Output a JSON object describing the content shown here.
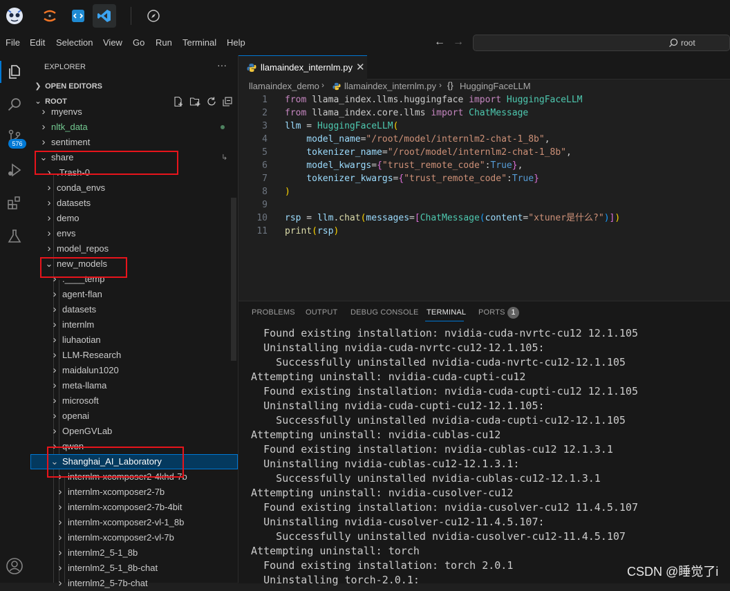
{
  "menu": [
    "File",
    "Edit",
    "Selection",
    "View",
    "Go",
    "Run",
    "Terminal",
    "Help"
  ],
  "search": {
    "text": "root"
  },
  "activity": {
    "badge": "576"
  },
  "explorer": {
    "title": "EXPLORER",
    "more": "···",
    "open_editors": "OPEN EDITORS",
    "root": "ROOT",
    "items": [
      {
        "label": "myenvs",
        "depth": 0,
        "expanded": false
      },
      {
        "label": "nltk_data",
        "depth": 0,
        "expanded": false,
        "color": "#73c991",
        "dot": true
      },
      {
        "label": "sentiment",
        "depth": 0,
        "expanded": false
      },
      {
        "label": "share",
        "depth": 0,
        "expanded": true,
        "mark": "↳"
      },
      {
        "label": ".Trash-0",
        "depth": 1,
        "expanded": false
      },
      {
        "label": "conda_envs",
        "depth": 1,
        "expanded": false
      },
      {
        "label": "datasets",
        "depth": 1,
        "expanded": false
      },
      {
        "label": "demo",
        "depth": 1,
        "expanded": false
      },
      {
        "label": "envs",
        "depth": 1,
        "expanded": false
      },
      {
        "label": "model_repos",
        "depth": 1,
        "expanded": false
      },
      {
        "label": "new_models",
        "depth": 1,
        "expanded": true
      },
      {
        "label": ".____temp",
        "depth": 2,
        "expanded": false
      },
      {
        "label": "agent-flan",
        "depth": 2,
        "expanded": false
      },
      {
        "label": "datasets",
        "depth": 2,
        "expanded": false
      },
      {
        "label": "internlm",
        "depth": 2,
        "expanded": false
      },
      {
        "label": "liuhaotian",
        "depth": 2,
        "expanded": false
      },
      {
        "label": "LLM-Research",
        "depth": 2,
        "expanded": false
      },
      {
        "label": "maidalun1020",
        "depth": 2,
        "expanded": false
      },
      {
        "label": "meta-llama",
        "depth": 2,
        "expanded": false
      },
      {
        "label": "microsoft",
        "depth": 2,
        "expanded": false
      },
      {
        "label": "openai",
        "depth": 2,
        "expanded": false
      },
      {
        "label": "OpenGVLab",
        "depth": 2,
        "expanded": false
      },
      {
        "label": "qwen",
        "depth": 2,
        "expanded": false
      },
      {
        "label": "Shanghai_AI_Laboratory",
        "depth": 2,
        "expanded": true,
        "selected": true
      },
      {
        "label": "internlm-xcomposer2-4khd-7b",
        "depth": 3,
        "expanded": false
      },
      {
        "label": "internlm-xcomposer2-7b",
        "depth": 3,
        "expanded": false
      },
      {
        "label": "internlm-xcomposer2-7b-4bit",
        "depth": 3,
        "expanded": false
      },
      {
        "label": "internlm-xcomposer2-vl-1_8b",
        "depth": 3,
        "expanded": false
      },
      {
        "label": "internlm-xcomposer2-vl-7b",
        "depth": 3,
        "expanded": false
      },
      {
        "label": "internlm2_5-1_8b",
        "depth": 3,
        "expanded": false
      },
      {
        "label": "internlm2_5-1_8b-chat",
        "depth": 3,
        "expanded": false
      },
      {
        "label": "internlm2_5-7b-chat",
        "depth": 3,
        "expanded": false
      }
    ]
  },
  "editor": {
    "tab_label": "llamaindex_internlm.py",
    "breadcrumb": [
      "llamaindex_demo",
      "llamaindex_internlm.py",
      "HuggingFaceLLM"
    ],
    "lines": [
      [
        [
          "from",
          "kw"
        ],
        [
          " llama_index.llms.huggingface ",
          ""
        ],
        [
          "import",
          "kw"
        ],
        [
          " HuggingFaceLLM",
          "cls"
        ]
      ],
      [
        [
          "from",
          "kw"
        ],
        [
          " llama_index.core.llms ",
          ""
        ],
        [
          "import",
          "kw"
        ],
        [
          " ChatMessage",
          "cls"
        ]
      ],
      [
        [
          "llm",
          "var"
        ],
        [
          " = ",
          ""
        ],
        [
          "HuggingFaceLLM",
          "cls"
        ],
        [
          "(",
          "par"
        ]
      ],
      [
        [
          "    model_name",
          "var"
        ],
        [
          "=",
          ""
        ],
        [
          "\"/root/model/internlm2-chat-1_8b\"",
          "str"
        ],
        [
          ",",
          ""
        ]
      ],
      [
        [
          "    tokenizer_name",
          "var"
        ],
        [
          "=",
          ""
        ],
        [
          "\"/root/model/internlm2-chat-1_8b\"",
          "str"
        ],
        [
          ",",
          ""
        ]
      ],
      [
        [
          "    model_kwargs",
          "var"
        ],
        [
          "=",
          ""
        ],
        [
          "{",
          "par2"
        ],
        [
          "\"trust_remote_code\"",
          "str"
        ],
        [
          ":",
          ""
        ],
        [
          "True",
          "const"
        ],
        [
          "}",
          "par2"
        ],
        [
          ",",
          ""
        ]
      ],
      [
        [
          "    tokenizer_kwargs",
          "var"
        ],
        [
          "=",
          ""
        ],
        [
          "{",
          "par2"
        ],
        [
          "\"trust_remote_code\"",
          "str"
        ],
        [
          ":",
          ""
        ],
        [
          "True",
          "const"
        ],
        [
          "}",
          "par2"
        ]
      ],
      [
        [
          ")",
          "par"
        ]
      ],
      [],
      [
        [
          "rsp",
          "var"
        ],
        [
          " = ",
          ""
        ],
        [
          "llm",
          "var"
        ],
        [
          ".",
          ""
        ],
        [
          "chat",
          "fn"
        ],
        [
          "(",
          "par"
        ],
        [
          "messages",
          "var"
        ],
        [
          "=",
          ""
        ],
        [
          "[",
          "par2"
        ],
        [
          "ChatMessage",
          "cls"
        ],
        [
          "(",
          "par3"
        ],
        [
          "content",
          "var"
        ],
        [
          "=",
          ""
        ],
        [
          "\"xtuner是什么?\"",
          "str"
        ],
        [
          ")",
          "par3"
        ],
        [
          "]",
          "par2"
        ],
        [
          ")",
          "par"
        ]
      ],
      [
        [
          "print",
          "fn"
        ],
        [
          "(",
          "par"
        ],
        [
          "rsp",
          "var"
        ],
        [
          ")",
          "par"
        ]
      ]
    ]
  },
  "panel": {
    "tabs": [
      "PROBLEMS",
      "OUTPUT",
      "DEBUG CONSOLE",
      "TERMINAL",
      "PORTS"
    ],
    "active_tab": "TERMINAL",
    "ports_count": "1",
    "terminal_lines": [
      "    Found existing installation: nvidia-cuda-nvrtc-cu12 12.1.105",
      "    Uninstalling nvidia-cuda-nvrtc-cu12-12.1.105:",
      "      Successfully uninstalled nvidia-cuda-nvrtc-cu12-12.1.105",
      "  Attempting uninstall: nvidia-cuda-cupti-cu12",
      "    Found existing installation: nvidia-cuda-cupti-cu12 12.1.105",
      "    Uninstalling nvidia-cuda-cupti-cu12-12.1.105:",
      "      Successfully uninstalled nvidia-cuda-cupti-cu12-12.1.105",
      "  Attempting uninstall: nvidia-cublas-cu12",
      "    Found existing installation: nvidia-cublas-cu12 12.1.3.1",
      "    Uninstalling nvidia-cublas-cu12-12.1.3.1:",
      "      Successfully uninstalled nvidia-cublas-cu12-12.1.3.1",
      "  Attempting uninstall: nvidia-cusolver-cu12",
      "    Found existing installation: nvidia-cusolver-cu12 11.4.5.107",
      "    Uninstalling nvidia-cusolver-cu12-11.4.5.107:",
      "      Successfully uninstalled nvidia-cusolver-cu12-11.4.5.107",
      "  Attempting uninstall: torch",
      "    Found existing installation: torch 2.0.1",
      "    Uninstalling torch-2.0.1:"
    ]
  },
  "watermark": "CSDN @睡觉了i",
  "colors": {
    "accent": "#0078d4",
    "highlight_box": "#e8141b",
    "selection": "#04395e"
  }
}
